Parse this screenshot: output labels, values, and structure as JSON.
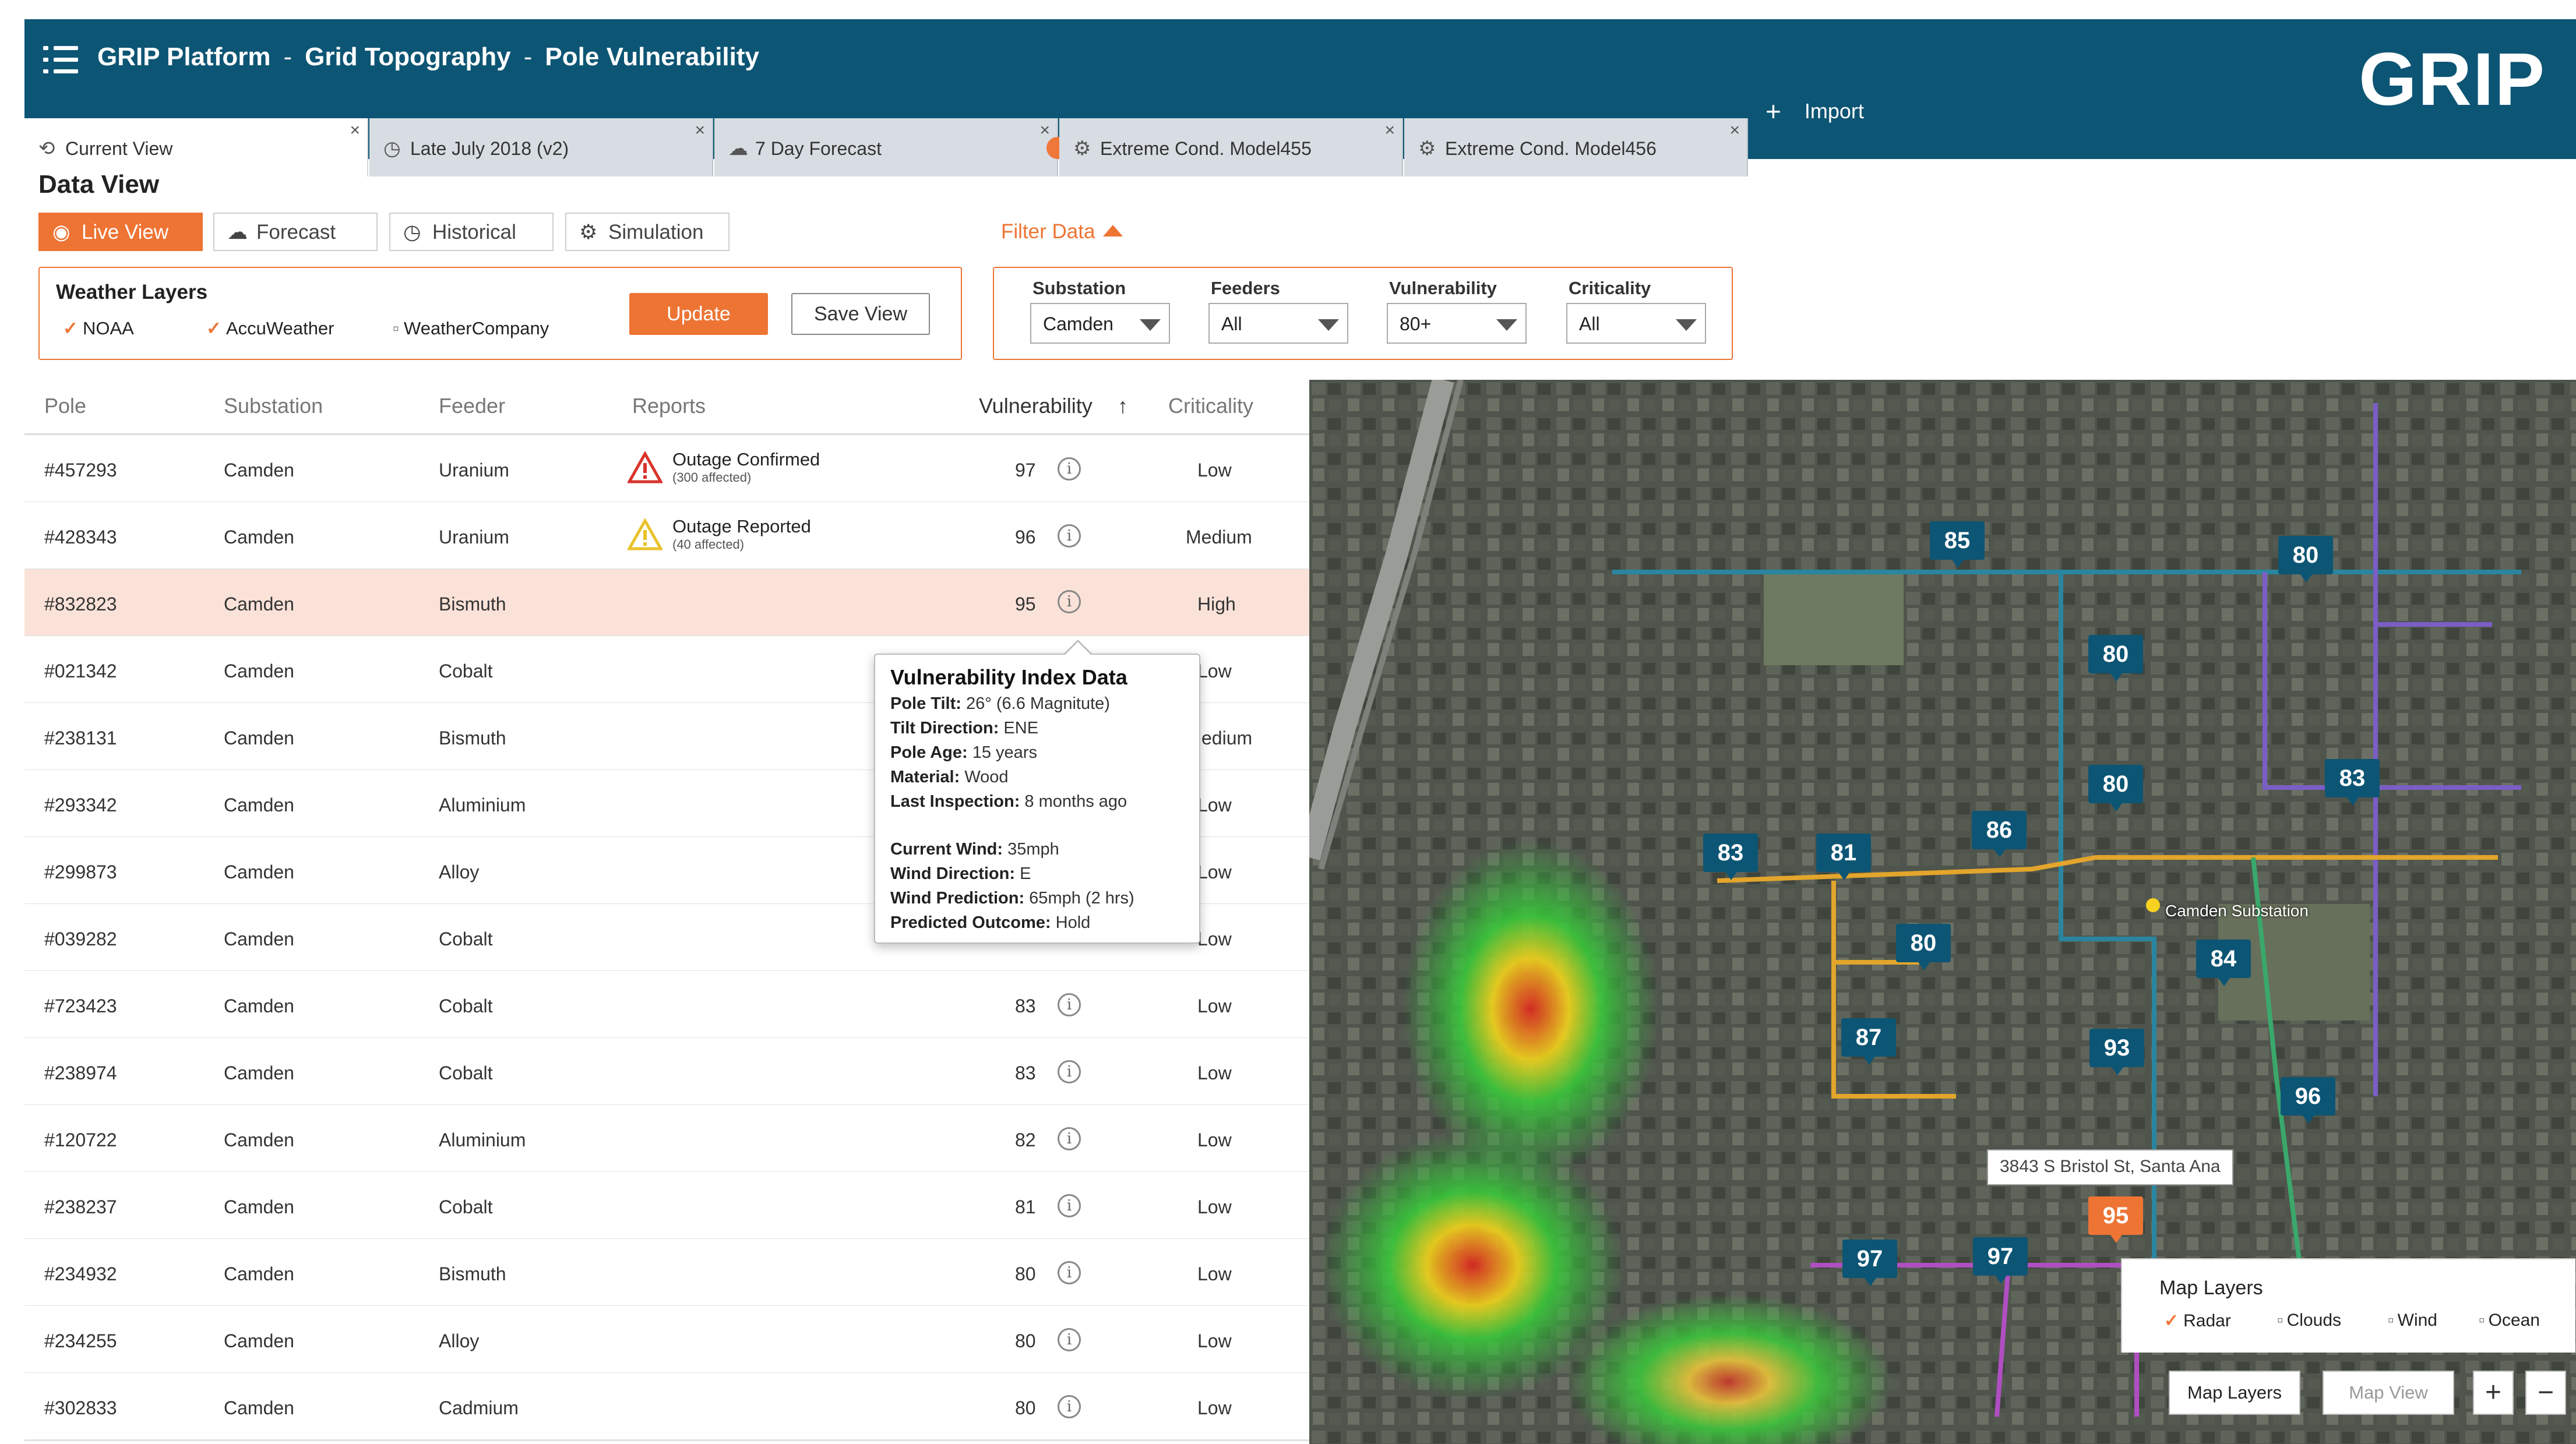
{
  "header": {
    "title_parts": [
      "GRIP Platform",
      "Grid Topography",
      "Pole Vulnerability"
    ],
    "separator": "-",
    "logo": "GRIP",
    "menu_icon": "hamburger-menu-icon"
  },
  "tabs": [
    {
      "label": "Current View",
      "icon": "view-icon",
      "close": "×"
    },
    {
      "label": "Late July 2018 (v2)",
      "icon": "history-icon",
      "close": "×"
    },
    {
      "label": "7 Day Forecast",
      "icon": "cloud-icon",
      "close": "×"
    },
    {
      "label": "Extreme Cond. Model455",
      "icon": "gear-icon",
      "close": "×"
    },
    {
      "label": "Extreme Cond. Model456",
      "icon": "gear-icon",
      "close": "×"
    }
  ],
  "import": {
    "plus": "+",
    "label": "Import"
  },
  "data_view": {
    "title": "Data View",
    "modes": [
      {
        "label": "Live View",
        "icon": "live-icon"
      },
      {
        "label": "Forecast",
        "icon": "cloud-icon"
      },
      {
        "label": "Historical",
        "icon": "history-icon"
      },
      {
        "label": "Simulation",
        "icon": "gear-icon"
      }
    ]
  },
  "weather_layers": {
    "title": "Weather Layers",
    "options": [
      {
        "label": "NOAA",
        "checked": true
      },
      {
        "label": "AccuWeather",
        "checked": true
      },
      {
        "label": "WeatherCompany",
        "checked": false
      }
    ],
    "update_label": "Update",
    "save_label": "Save View"
  },
  "filter": {
    "title": "Filter Data",
    "fields": [
      {
        "label": "Substation",
        "value": "Camden"
      },
      {
        "label": "Feeders",
        "value": "All"
      },
      {
        "label": "Vulnerability",
        "value": "80+"
      },
      {
        "label": "Criticality",
        "value": "All"
      }
    ]
  },
  "table": {
    "columns": [
      "Pole",
      "Substation",
      "Feeder",
      "Reports",
      "Vulnerability",
      "Criticality"
    ],
    "sort_indicator": "↑",
    "rows": [
      {
        "pole": "#457293",
        "substation": "Camden",
        "feeder": "Uranium",
        "report": "Outage Confirmed",
        "report_sub": "(300 affected)",
        "report_level": "red",
        "vuln": "97",
        "crit": "Low"
      },
      {
        "pole": "#428343",
        "substation": "Camden",
        "feeder": "Uranium",
        "report": "Outage Reported",
        "report_sub": "(40 affected)",
        "report_level": "yellow",
        "vuln": "96",
        "crit": "Medium"
      },
      {
        "pole": "#832823",
        "substation": "Camden",
        "feeder": "Bismuth",
        "report": "",
        "report_sub": "",
        "vuln": "95",
        "crit": "High"
      },
      {
        "pole": "#021342",
        "substation": "Camden",
        "feeder": "Cobalt",
        "report": "",
        "report_sub": "",
        "vuln": "",
        "crit": "Low"
      },
      {
        "pole": "#238131",
        "substation": "Camden",
        "feeder": "Bismuth",
        "report": "",
        "report_sub": "",
        "vuln": "",
        "crit": "edium"
      },
      {
        "pole": "#293342",
        "substation": "Camden",
        "feeder": "Aluminium",
        "report": "",
        "report_sub": "",
        "vuln": "",
        "crit": "Low"
      },
      {
        "pole": "#299873",
        "substation": "Camden",
        "feeder": "Alloy",
        "report": "",
        "report_sub": "",
        "vuln": "",
        "crit": "Low"
      },
      {
        "pole": "#039282",
        "substation": "Camden",
        "feeder": "Cobalt",
        "report": "",
        "report_sub": "",
        "vuln": "",
        "crit": "Low"
      },
      {
        "pole": "#723423",
        "substation": "Camden",
        "feeder": "Cobalt",
        "report": "",
        "report_sub": "",
        "vuln": "83",
        "crit": "Low"
      },
      {
        "pole": "#238974",
        "substation": "Camden",
        "feeder": "Cobalt",
        "report": "",
        "report_sub": "",
        "vuln": "83",
        "crit": "Low"
      },
      {
        "pole": "#120722",
        "substation": "Camden",
        "feeder": "Aluminium",
        "report": "",
        "report_sub": "",
        "vuln": "82",
        "crit": "Low"
      },
      {
        "pole": "#238237",
        "substation": "Camden",
        "feeder": "Cobalt",
        "report": "",
        "report_sub": "",
        "vuln": "81",
        "crit": "Low"
      },
      {
        "pole": "#234932",
        "substation": "Camden",
        "feeder": "Bismuth",
        "report": "",
        "report_sub": "",
        "vuln": "80",
        "crit": "Low"
      },
      {
        "pole": "#234255",
        "substation": "Camden",
        "feeder": "Alloy",
        "report": "",
        "report_sub": "",
        "vuln": "80",
        "crit": "Low"
      },
      {
        "pole": "#302833",
        "substation": "Camden",
        "feeder": "Cadmium",
        "report": "",
        "report_sub": "",
        "vuln": "80",
        "crit": "Low"
      }
    ]
  },
  "tooltip": {
    "title": "Vulnerability Index Data",
    "lines": [
      {
        "k": "Pole Tilt:",
        "v": " 26° (6.6 Magnitute)"
      },
      {
        "k": "Tilt Direction:",
        "v": " ENE"
      },
      {
        "k": "Pole Age:",
        "v": " 15 years"
      },
      {
        "k": "Material:",
        "v": " Wood"
      },
      {
        "k": "Last Inspection:",
        "v": " 8 months ago"
      },
      {
        "k": "Current Wind:",
        "v": "  35mph"
      },
      {
        "k": "Wind Direction:",
        "v": " E"
      },
      {
        "k": "Wind Prediction:",
        "v": " 65mph (2 hrs)"
      },
      {
        "k": "Predicted Outcome:",
        "v": " Hold"
      }
    ]
  },
  "map": {
    "badges": [
      "85",
      "80",
      "80",
      "80",
      "83",
      "83",
      "81",
      "86",
      "80",
      "84",
      "87",
      "93",
      "96",
      "97",
      "97",
      "95"
    ],
    "substation_label": "Camden Substation",
    "address": "3843 S Bristol St, Santa Ana",
    "layers_title": "Map Layers",
    "layer_options": [
      {
        "label": "Radar",
        "checked": true
      },
      {
        "label": "Clouds",
        "checked": false
      },
      {
        "label": "Wind",
        "checked": false
      },
      {
        "label": "Ocean",
        "checked": false
      }
    ],
    "buttons": {
      "layers": "Map Layers",
      "view": "Map View",
      "zoom_in": "+",
      "zoom_out": "−"
    }
  },
  "colors": {
    "brand": "#0d5574",
    "accent": "#ee7434",
    "highlight_row": "#fbe2d9"
  }
}
